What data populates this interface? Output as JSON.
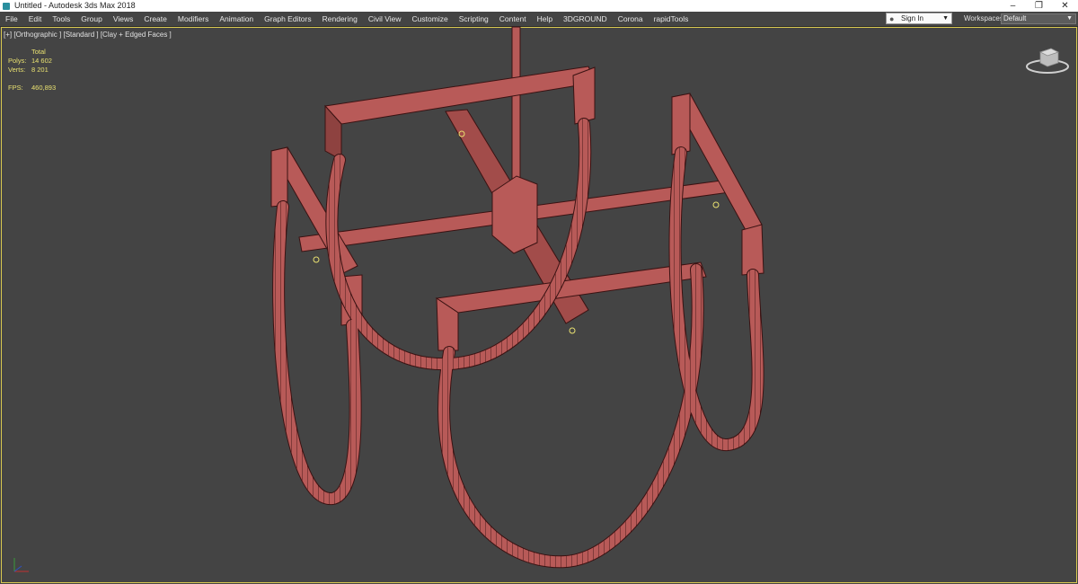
{
  "window": {
    "title": "Untitled - Autodesk 3ds Max 2018"
  },
  "menu": {
    "items": [
      "File",
      "Edit",
      "Tools",
      "Group",
      "Views",
      "Create",
      "Modifiers",
      "Animation",
      "Graph Editors",
      "Rendering",
      "Civil View",
      "Customize",
      "Scripting",
      "Content",
      "Help",
      "3DGROUND",
      "Corona",
      "rapidTools"
    ]
  },
  "account": {
    "sign_in_label": "Sign In"
  },
  "workspaces": {
    "label": "Workspaces:",
    "value": "Default"
  },
  "viewport": {
    "label": "[+] [Orthographic ] [Standard ] [Clay + Edged Faces ]",
    "stats": {
      "header": "Total",
      "polys_label": "Polys:",
      "polys_value": "14 602",
      "verts_label": "Verts:",
      "verts_value": "8 201",
      "fps_label": "FPS:",
      "fps_value": "460,893"
    }
  },
  "colors": {
    "model": "#b85a58",
    "model_dark": "#7a3634",
    "wire": "#3a1212",
    "background": "#444444",
    "stats_text": "#e8e070"
  }
}
